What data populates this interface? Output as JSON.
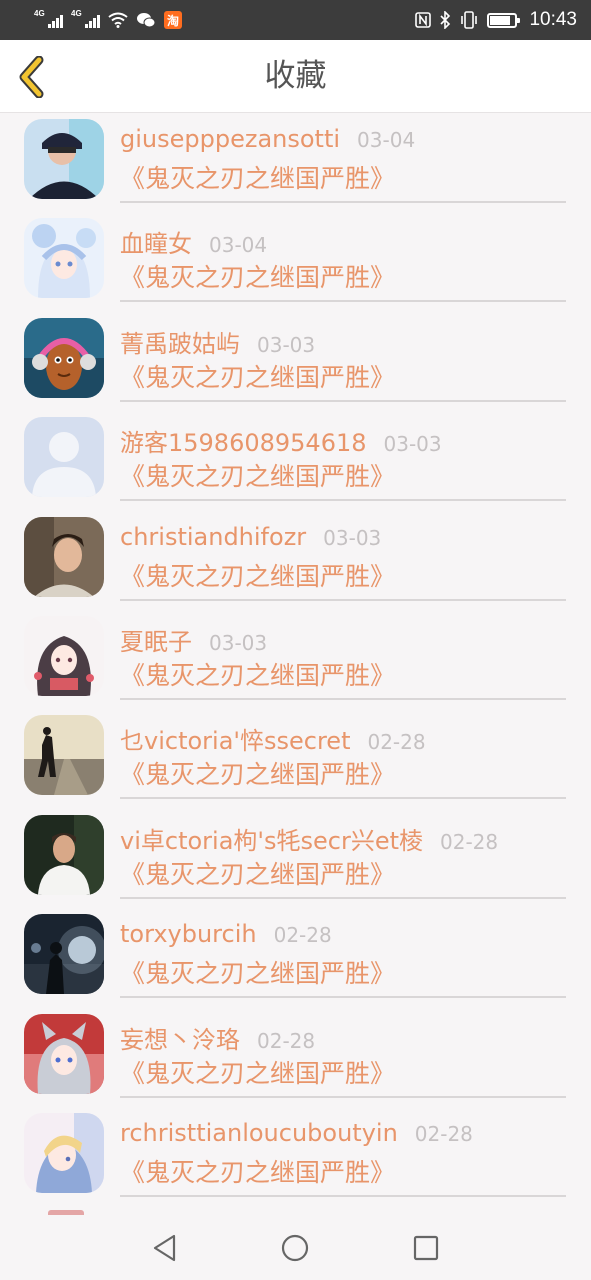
{
  "status_bar": {
    "network1": "4G",
    "network2": "4G",
    "taobao_glyph": "淘",
    "battery_level": 0.8,
    "time": "10:43",
    "icons": [
      "signal-icon",
      "signal-icon",
      "wifi-icon",
      "wechat-icon",
      "taobao-icon",
      "nfc-icon",
      "bluetooth-icon",
      "vibrate-icon",
      "battery-icon"
    ]
  },
  "header": {
    "title": "收藏",
    "back_icon": "chevron-left-icon",
    "accent": "#f2c430"
  },
  "colors": {
    "name": "#e8956a",
    "date": "#c5c1c2",
    "divider": "#d9d6d7"
  },
  "favorites": [
    {
      "name": "giusepppezansotti",
      "date": "03-04",
      "work": "《鬼灭之刃之继国严胜》",
      "avatar": "avatar-man-hat"
    },
    {
      "name": "血瞳女",
      "date": "03-04",
      "work": "《鬼灭之刃之继国严胜》",
      "avatar": "avatar-anime-girl-blue"
    },
    {
      "name": "菁禹跛姑屿",
      "date": "03-03",
      "work": "《鬼灭之刃之继国严胜》",
      "avatar": "avatar-headphones"
    },
    {
      "name": "游客1598608954618",
      "date": "03-03",
      "work": "《鬼灭之刃之继国严胜》",
      "avatar": "avatar-default"
    },
    {
      "name": "christiandhifozr",
      "date": "03-03",
      "work": "《鬼灭之刃之继国严胜》",
      "avatar": "avatar-man-portrait"
    },
    {
      "name": "夏眠子",
      "date": "03-03",
      "work": "《鬼灭之刃之继国严胜》",
      "avatar": "avatar-anime-girl-dark"
    },
    {
      "name": "乜victoria'悴ssecret",
      "date": "02-28",
      "work": "《鬼灭之刃之继国严胜》",
      "avatar": "avatar-road"
    },
    {
      "name": "vi卓ctoria枸's牦secr兴et棱",
      "date": "02-28",
      "work": "《鬼灭之刃之继国严胜》",
      "avatar": "avatar-man-tshirt"
    },
    {
      "name": "torxyburcih",
      "date": "02-28",
      "work": "《鬼灭之刃之继国严胜》",
      "avatar": "avatar-night-lights"
    },
    {
      "name": "妄想丶泠珞",
      "date": "02-28",
      "work": "《鬼灭之刃之继国严胜》",
      "avatar": "avatar-anime-catgirl"
    },
    {
      "name": "rchristtianloucuboutyin",
      "date": "02-28",
      "work": "《鬼灭之刃之继国严胜》",
      "avatar": "avatar-anime-boy"
    }
  ],
  "nav": {
    "back": "triangle-back-icon",
    "home": "circle-home-icon",
    "recents": "square-recents-icon"
  }
}
